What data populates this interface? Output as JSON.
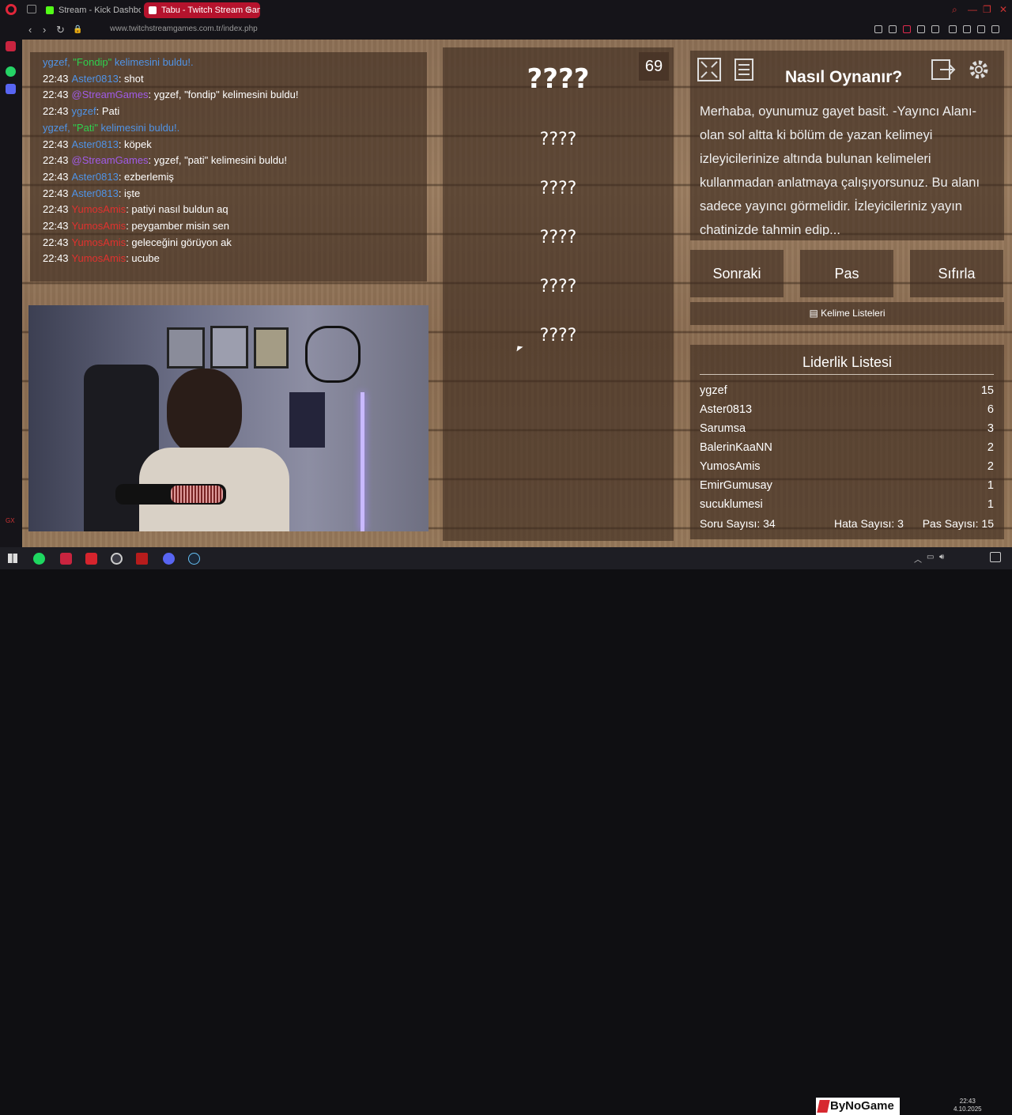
{
  "browser": {
    "tabs": [
      {
        "label": "Stream - Kick Dashboard",
        "active": false
      },
      {
        "label": "Tabu - Twitch Stream Games",
        "active": true
      }
    ],
    "url_host": "www.twitchstreamgames.com.tr",
    "url_path": "/index.php"
  },
  "chat": {
    "messages": [
      {
        "time": "",
        "user": "",
        "text": "ygzef, \"Fondip\" kelimesini buldu!.",
        "user_color": "system"
      },
      {
        "time": "22:43",
        "user": "Aster0813",
        "text": ": shot",
        "user_color": "blue"
      },
      {
        "time": "22:43",
        "user": "@StreamGames",
        "text": ": ygzef, \"fondip\" kelimesini buldu!",
        "user_color": "purple"
      },
      {
        "time": "22:43",
        "user": "ygzef",
        "text": ": Pati",
        "user_color": "blue"
      },
      {
        "time": "",
        "user": "",
        "text": "ygzef, \"Pati\" kelimesini buldu!.",
        "user_color": "system"
      },
      {
        "time": "22:43",
        "user": "Aster0813",
        "text": ": köpek",
        "user_color": "blue"
      },
      {
        "time": "22:43",
        "user": "@StreamGames",
        "text": ": ygzef, \"pati\" kelimesini buldu!",
        "user_color": "purple"
      },
      {
        "time": "22:43",
        "user": "Aster0813",
        "text": ": ezberlemiş",
        "user_color": "blue"
      },
      {
        "time": "22:43",
        "user": "Aster0813",
        "text": ": işte",
        "user_color": "blue"
      },
      {
        "time": "22:43",
        "user": "YumosAmis",
        "text": ": patiyi nasıl buldun aq",
        "user_color": "red"
      },
      {
        "time": "22:43",
        "user": "YumosAmis",
        "text": ": peygamber misin sen",
        "user_color": "red"
      },
      {
        "time": "22:43",
        "user": "YumosAmis",
        "text": ": geleceğini görüyon ak",
        "user_color": "red"
      },
      {
        "time": "22:43",
        "user": "YumosAmis",
        "text": ": ucube",
        "user_color": "red"
      }
    ]
  },
  "game": {
    "timer": "69",
    "main_word": "????",
    "taboo_words": [
      "????",
      "????",
      "????",
      "????",
      "????"
    ]
  },
  "howto": {
    "title": "Nasıl Oynanır?",
    "text": "Merhaba, oyunumuz gayet basit. -Yayıncı Alanı- olan sol altta ki bölüm de yazan kelimeyi izleyicilerinize altında bulunan kelimeleri kullanmadan anlatmaya çalışıyorsunuz. Bu alanı sadece yayıncı görmelidir. İzleyicileriniz yayın chatinizde tahmin edip..."
  },
  "buttons": {
    "next": "Sonraki",
    "pass": "Pas",
    "reset": "Sıfırla",
    "word_lists": "Kelime Listeleri"
  },
  "leaderboard": {
    "title": "Liderlik Listesi",
    "rows": [
      {
        "name": "ygzef",
        "score": "15"
      },
      {
        "name": "Aster0813",
        "score": "6"
      },
      {
        "name": "Sarumsa",
        "score": "3"
      },
      {
        "name": "BalerinKaaNN",
        "score": "2"
      },
      {
        "name": "YumosAmis",
        "score": "2"
      },
      {
        "name": "EmirGumusay",
        "score": "1"
      },
      {
        "name": "sucuklumesi",
        "score": "1"
      }
    ],
    "question_count": "Soru Sayısı: 34",
    "error_count": "Hata Sayısı: 3",
    "pass_count": "Pas Sayısı: 15"
  },
  "taskbar": {
    "brand": "ByNoGame",
    "time": "22:43",
    "date": "4.10.2025"
  },
  "colors": {
    "chat_blue": "#4f93e6",
    "chat_purple": "#a05be8",
    "chat_red": "#e0312e",
    "chat_green": "#2ed14e",
    "accent_tab": "#b5132d"
  }
}
